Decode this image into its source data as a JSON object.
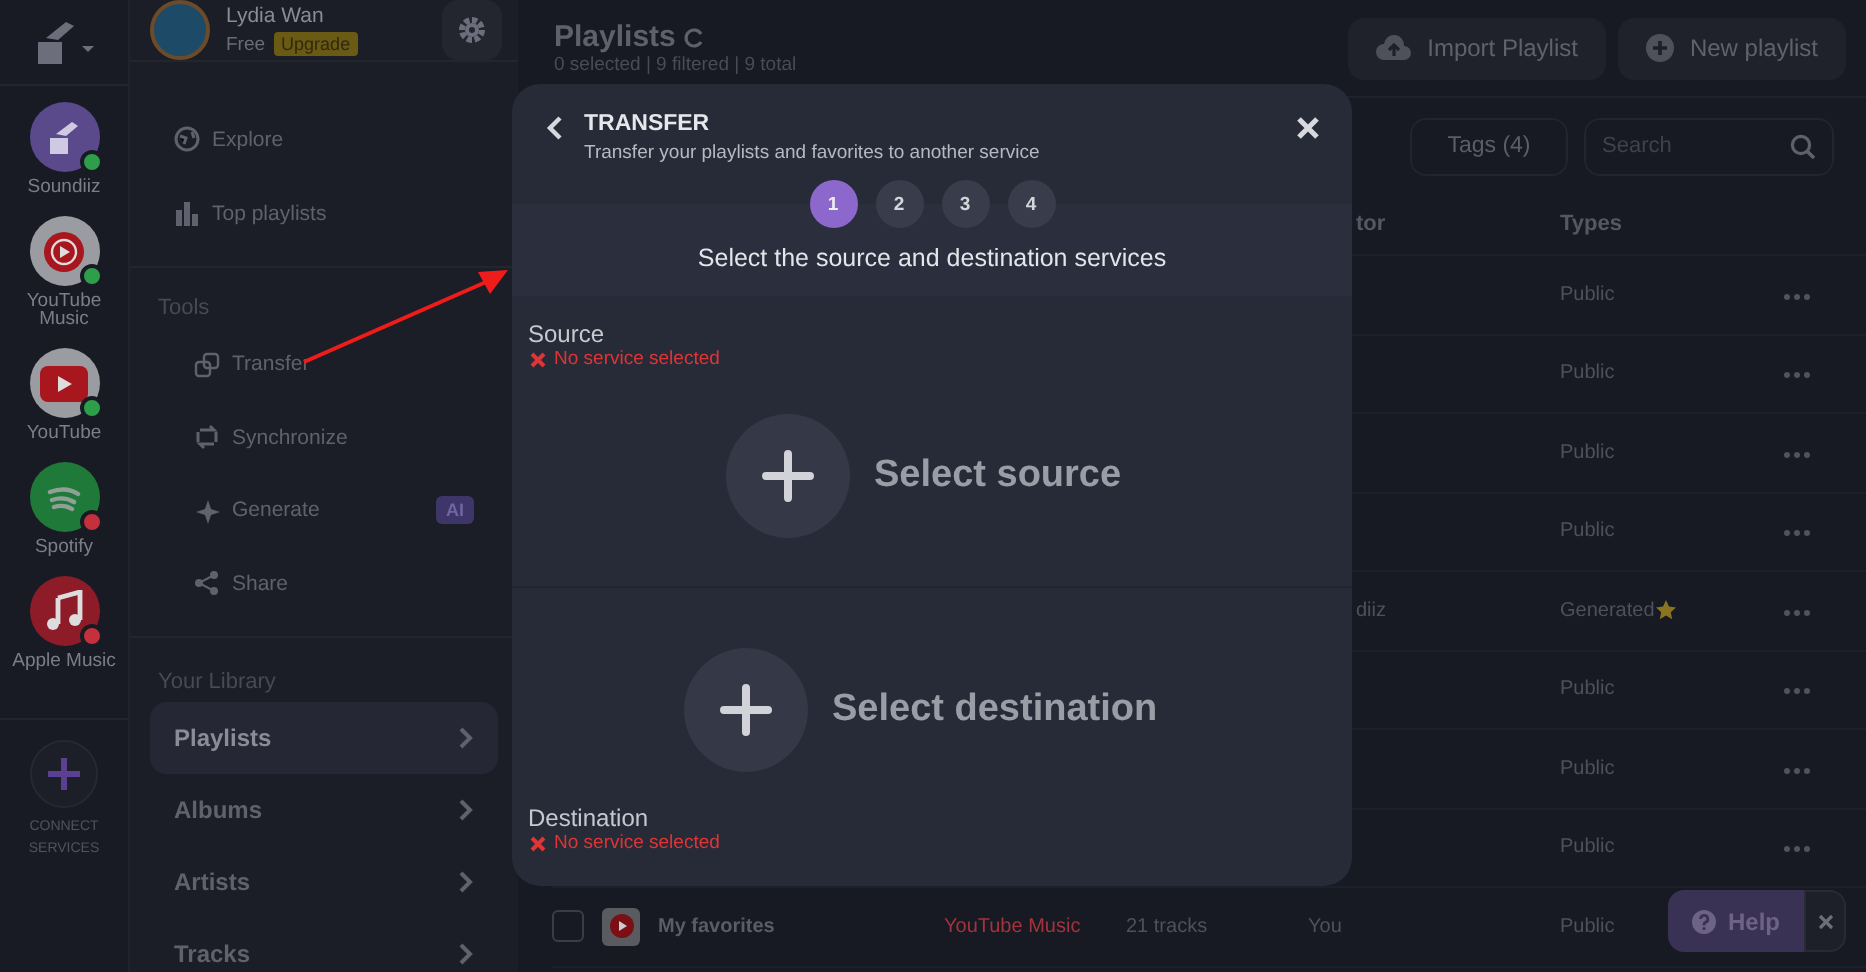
{
  "rail": {
    "services": [
      {
        "name": "Soundiiz",
        "kind": "soundiiz",
        "color": "#2f9e4a"
      },
      {
        "name": "YouTube Music",
        "kind": "youtube-music",
        "color": "#2f9e4a"
      },
      {
        "name": "YouTube",
        "kind": "youtube",
        "color": "#2f9e4a"
      },
      {
        "name": "Spotify",
        "kind": "spotify",
        "color": "#c4303c"
      },
      {
        "name": "Apple Music",
        "kind": "apple-music",
        "color": "#c4303c"
      }
    ],
    "connect_label": "CONNECT SERVICES"
  },
  "sidebar": {
    "user": {
      "name": "Lydia Wan",
      "plan": "Free",
      "upgrade": "Upgrade"
    },
    "groups": [
      {
        "items": [
          {
            "label": "Explore",
            "kind": "globe",
            "selected": false
          },
          {
            "label": "Top playlists",
            "kind": "chart",
            "selected": false
          }
        ]
      },
      {
        "title": "Tools",
        "items": [
          {
            "label": "Transfer",
            "kind": "transfer",
            "selected": false
          },
          {
            "label": "Synchronize",
            "kind": "sync",
            "selected": false
          },
          {
            "label": "Generate",
            "kind": "sparkle",
            "badge": "AI",
            "selected": false
          },
          {
            "label": "Share",
            "kind": "share",
            "selected": false
          }
        ]
      },
      {
        "title": "Your Library",
        "items": [
          {
            "label": "Playlists",
            "kind": "chevron",
            "selected": true
          },
          {
            "label": "Albums",
            "kind": "chevron",
            "selected": false
          },
          {
            "label": "Artists",
            "kind": "chevron",
            "selected": false
          },
          {
            "label": "Tracks",
            "kind": "chevron",
            "selected": false
          }
        ]
      }
    ]
  },
  "main": {
    "title": "Playlists",
    "stats": "0 selected | 9 filtered | 9 total",
    "buttons": [
      {
        "label": "Import Playlist",
        "kind": "upload"
      },
      {
        "label": "New playlist",
        "kind": "plus"
      }
    ],
    "filters": [
      {
        "label": "Tags (4)"
      }
    ],
    "search": {
      "placeholder": "Search"
    },
    "table": {
      "columns": [
        "tor",
        "Types"
      ],
      "rows": [
        {
          "type": "Public"
        },
        {
          "type": "Public"
        },
        {
          "type": "Public"
        },
        {
          "type": "Public"
        },
        {
          "creator": "diiz",
          "type": "Generated",
          "starred": true
        },
        {
          "type": "Public"
        },
        {
          "type": "Public"
        },
        {
          "type": "Public"
        },
        {
          "checked": false,
          "name": "My favorites",
          "service": "YouTube Music",
          "tracks": "21 tracks",
          "creator": "You",
          "type": "Public"
        }
      ]
    }
  },
  "help": {
    "label": "Help"
  },
  "modal": {
    "title": "TRANSFER",
    "subtitle": "Transfer your playlists and favorites to another service",
    "steps": [
      {
        "label": "1",
        "selected": true
      },
      {
        "label": "2",
        "selected": false
      },
      {
        "label": "3",
        "selected": false
      },
      {
        "label": "4",
        "selected": false
      }
    ],
    "heading": "Select the source and destination services",
    "source": {
      "label": "Source",
      "error": "No service selected",
      "action": "Select source"
    },
    "destination": {
      "label": "Destination",
      "error": "No service selected",
      "action": "Select destination"
    }
  }
}
